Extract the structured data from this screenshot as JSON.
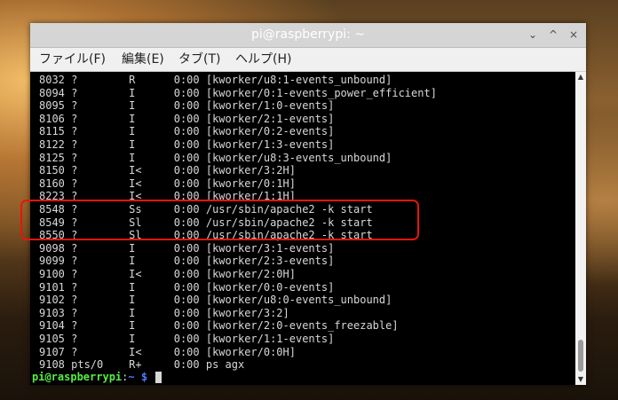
{
  "window": {
    "title": "pi@raspberrypi: ~",
    "controls": {
      "minimize": "⌄",
      "maximize": "^",
      "close": "×"
    }
  },
  "menu": {
    "file": "ファイル(F)",
    "edit": "編集(E)",
    "tab": "タブ(T)",
    "help": "ヘルプ(H)"
  },
  "terminal": {
    "lines": [
      "8032 ?        R      0:00 [kworker/u8:1-events_unbound]",
      "8094 ?        I      0:00 [kworker/0:1-events_power_efficient]",
      "8095 ?        I      0:00 [kworker/1:0-events]",
      "8106 ?        I      0:00 [kworker/2:1-events]",
      "8115 ?        I      0:00 [kworker/0:2-events]",
      "8122 ?        I      0:00 [kworker/1:3-events]",
      "8125 ?        I      0:00 [kworker/u8:3-events_unbound]",
      "8150 ?        I<     0:00 [kworker/3:2H]",
      "8160 ?        I<     0:00 [kworker/0:1H]",
      "8223 ?        I<     0:00 [kworker/1:1H]",
      "8548 ?        Ss     0:00 /usr/sbin/apache2 -k start",
      "8549 ?        Sl     0:00 /usr/sbin/apache2 -k start",
      "8550 ?        Sl     0:00 /usr/sbin/apache2 -k start",
      "9098 ?        I      0:00 [kworker/3:1-events]",
      "9099 ?        I      0:00 [kworker/2:3-events]",
      "9100 ?        I<     0:00 [kworker/2:0H]",
      "9101 ?        I      0:00 [kworker/0:0-events]",
      "9102 ?        I      0:00 [kworker/u8:0-events_unbound]",
      "9103 ?        I      0:00 [kworker/3:2]",
      "9104 ?        I      0:00 [kworker/2:0-events_freezable]",
      "9105 ?        I      0:00 [kworker/1:1-events]",
      "9107 ?        I<     0:00 [kworker/0:0H]",
      "9108 pts/0    R+     0:00 ps agx"
    ],
    "prompt": {
      "user": "pi@raspberrypi",
      "sep": ":",
      "path": "~ $"
    }
  },
  "colors": {
    "highlight": "#e8140c",
    "prompt_user": "#55ee44",
    "prompt_path": "#5577ff"
  }
}
